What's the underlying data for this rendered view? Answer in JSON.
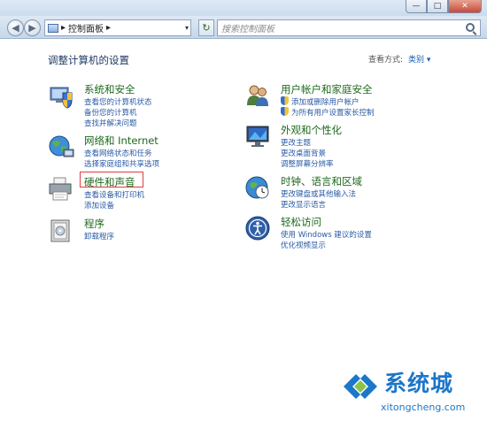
{
  "window": {
    "minimize_glyph": "—",
    "maximize_glyph": "□",
    "close_glyph": "✕"
  },
  "nav": {
    "back_glyph": "◀",
    "forward_glyph": "▶",
    "address_arrow": "▸",
    "address_text": "控制面板",
    "address_after": "▸",
    "dropdown_glyph": "▾",
    "refresh_glyph": "↻",
    "search_placeholder": "搜索控制面板"
  },
  "main": {
    "heading": "调整计算机的设置",
    "view_by_label": "查看方式:",
    "view_by_value": "类别 ▾"
  },
  "categories_left": [
    {
      "title": "系统和安全",
      "links": [
        "查看您的计算机状态",
        "备份您的计算机",
        "查找并解决问题"
      ]
    },
    {
      "title": "网络和 Internet",
      "links": [
        "查看网络状态和任务",
        "选择家庭组和共享选项"
      ]
    },
    {
      "title": "硬件和声音",
      "links": [
        "查看设备和打印机",
        "添加设备"
      ]
    },
    {
      "title": "程序",
      "links": [
        "卸载程序"
      ]
    }
  ],
  "categories_right": [
    {
      "title": "用户帐户和家庭安全",
      "links": [
        "添加或删除用户帐户",
        "为所有用户设置家长控制"
      ]
    },
    {
      "title": "外观和个性化",
      "links": [
        "更改主题",
        "更改桌面背景",
        "调整屏幕分辨率"
      ]
    },
    {
      "title": "时钟、语言和区域",
      "links": [
        "更改键盘或其他输入法",
        "更改显示语言"
      ]
    },
    {
      "title": "轻松访问",
      "links": [
        "使用 Windows 建议的设置",
        "优化视频显示"
      ]
    }
  ],
  "watermark": {
    "brand": "系统城",
    "url": "xitongcheng.com"
  },
  "colors": {
    "category_title": "#1d6a1d",
    "link": "#2a5aa5",
    "highlight_box": "#e03c3c",
    "watermark": "#1c76c9"
  },
  "icons": {
    "system_security": "shield-pc-icon",
    "network": "globe-network-icon",
    "hardware_sound": "printer-speaker-icon",
    "programs": "programs-box-icon",
    "user_accounts": "users-icon",
    "appearance": "display-icon",
    "clock_region": "globe-clock-icon",
    "ease_of_access": "ease-of-access-icon"
  }
}
